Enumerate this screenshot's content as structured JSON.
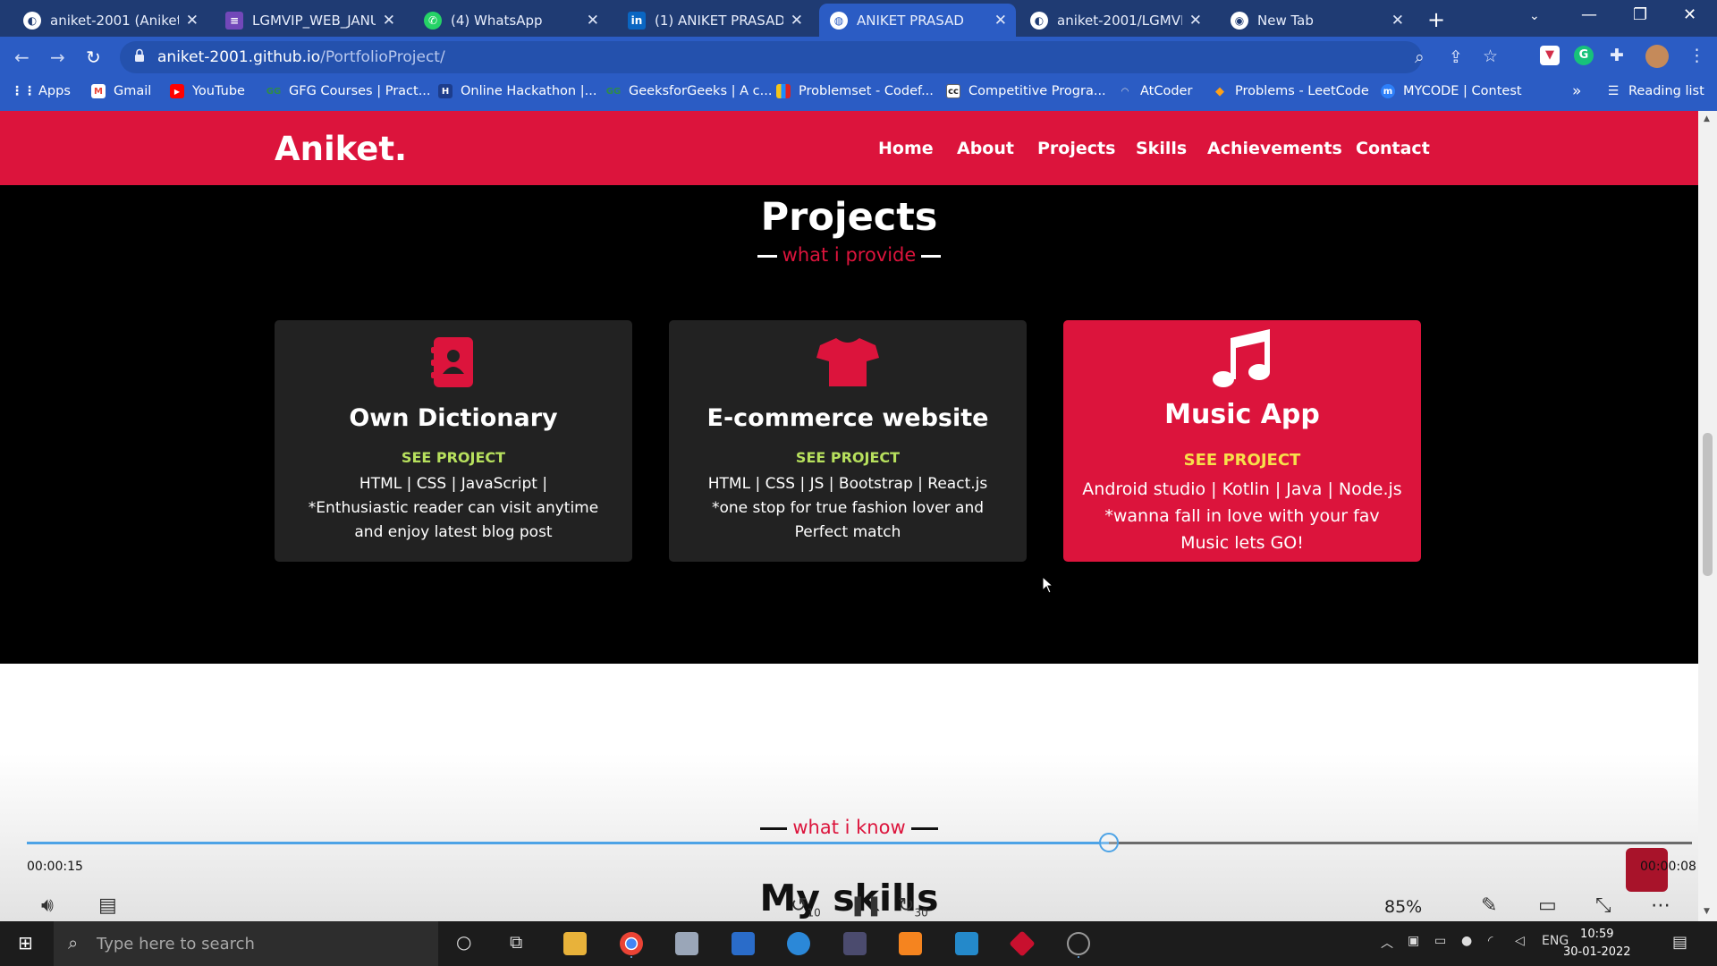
{
  "browser": {
    "tabs": [
      {
        "title": "aniket-2001 (Aniket P",
        "favicon": "github-icon",
        "active": false
      },
      {
        "title": "LGMVIP_WEB_JANUA",
        "favicon": "forms-icon",
        "active": false
      },
      {
        "title": "(4) WhatsApp",
        "favicon": "whatsapp-icon",
        "active": false
      },
      {
        "title": "(1) ANIKET PRASAD |",
        "favicon": "linkedin-icon",
        "active": false
      },
      {
        "title": "ANIKET PRASAD",
        "favicon": "globe-icon",
        "active": true
      },
      {
        "title": "aniket-2001/LGMVIP",
        "favicon": "github-icon",
        "active": false
      },
      {
        "title": "New Tab",
        "favicon": "chrome-icon",
        "active": false
      }
    ],
    "url_host": "aniket-2001.github.io",
    "url_path": "/PortfolioProject/",
    "bookmarks": [
      "Apps",
      "Gmail",
      "YouTube",
      "GFG Courses | Pract...",
      "Online Hackathon |...",
      "GeeksforGeeks | A c...",
      "Problemset - Codef...",
      "Competitive Progra...",
      "AtCoder",
      "Problems - LeetCode",
      "MYCODE | Contest"
    ],
    "bookmarks_overflow": "»",
    "reading_list": "Reading list"
  },
  "site": {
    "logo": "Aniket.",
    "nav": [
      "Home",
      "About",
      "Projects",
      "Skills",
      "Achievements",
      "Contact"
    ],
    "projects": {
      "title": "Projects",
      "subtitle": "what i provide",
      "cards": [
        {
          "icon": "address-book-icon",
          "title": "Own Dictionary",
          "link": "SEE PROJECT",
          "tech": "HTML | CSS | JavaScript |",
          "desc": "*Enthusiastic reader can visit anytime and enjoy latest blog post"
        },
        {
          "icon": "tshirt-icon",
          "title": "E-commerce website",
          "link": "SEE PROJECT",
          "tech": "HTML | CSS | JS | Bootstrap | React.js",
          "desc": "*one stop for true fashion lover and Perfect match"
        },
        {
          "icon": "music-icon",
          "title": "Music App",
          "link": "SEE PROJECT",
          "tech": "Android studio | Kotlin | Java | Node.js",
          "desc": "*wanna fall in love with your fav Music lets GO!"
        }
      ]
    },
    "skills": {
      "title": "My skills",
      "subtitle": "what i know"
    }
  },
  "player": {
    "elapsed": "00:00:15",
    "remaining": "00:00:08",
    "progress": 0.65,
    "zoom": "85%",
    "skip_back": "10",
    "skip_fwd": "30"
  },
  "taskbar": {
    "search_placeholder": "Type here to search",
    "lang": "ENG",
    "time": "10:59",
    "date": "30-01-2022"
  },
  "colors": {
    "brand": "#dc143c",
    "chrome": "#2b5cc4",
    "tabbar": "#1f3b73",
    "see_project": "#b7e05d"
  }
}
